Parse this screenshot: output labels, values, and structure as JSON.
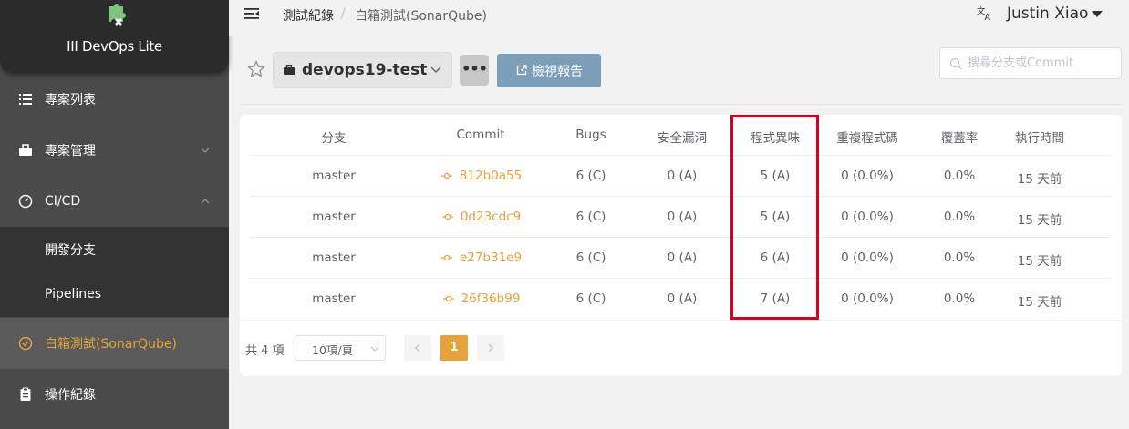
{
  "app": {
    "logo_text": "III DevOps Lite"
  },
  "sidebar": {
    "items": [
      {
        "label": "專案列表",
        "icon": "list-icon"
      },
      {
        "label": "專案管理",
        "icon": "briefcase-icon"
      },
      {
        "label": "CI/CD",
        "icon": "gauge-icon"
      },
      {
        "label": "開發分支"
      },
      {
        "label": "Pipelines"
      },
      {
        "label": "白箱測試(SonarQube)",
        "icon": "check-circle-icon",
        "active": true
      },
      {
        "label": "操作紀錄",
        "icon": "clipboard-icon"
      }
    ]
  },
  "header": {
    "breadcrumb": [
      "測試紀錄",
      "白箱測試(SonarQube)"
    ],
    "breadcrumb_sep": "/",
    "user_name": "Justin Xiao"
  },
  "toolbar": {
    "project": "devops19-test",
    "more_label": "•••",
    "report_label": "檢視報告",
    "search_placeholder": "搜尋分支或Commit"
  },
  "table": {
    "columns": [
      "分支",
      "Commit",
      "Bugs",
      "安全漏洞",
      "程式異味",
      "重複程式碼",
      "覆蓋率",
      "執行時間"
    ],
    "rows": [
      {
        "branch": "master",
        "commit": "812b0a55",
        "bugs": "6 (C)",
        "vulnerabilities": "0 (A)",
        "code_smells": "5 (A)",
        "duplications": "0 (0.0%)",
        "coverage": "0.0%",
        "time": "15 天前"
      },
      {
        "branch": "master",
        "commit": "0d23cdc9",
        "bugs": "6 (C)",
        "vulnerabilities": "0 (A)",
        "code_smells": "5 (A)",
        "duplications": "0 (0.0%)",
        "coverage": "0.0%",
        "time": "15 天前"
      },
      {
        "branch": "master",
        "commit": "e27b31e9",
        "bugs": "6 (C)",
        "vulnerabilities": "0 (A)",
        "code_smells": "6 (A)",
        "duplications": "0 (0.0%)",
        "coverage": "0.0%",
        "time": "15 天前"
      },
      {
        "branch": "master",
        "commit": "26f36b99",
        "bugs": "6 (C)",
        "vulnerabilities": "0 (A)",
        "code_smells": "7 (A)",
        "duplications": "0 (0.0%)",
        "coverage": "0.0%",
        "time": "15 天前"
      }
    ]
  },
  "pagination": {
    "total": "共 4 項",
    "page_size": "10項/頁",
    "current_page": "1"
  },
  "colors": {
    "accent": "#e6a23c",
    "highlight": "#d9001b",
    "report_button": "#7c9fb9"
  }
}
